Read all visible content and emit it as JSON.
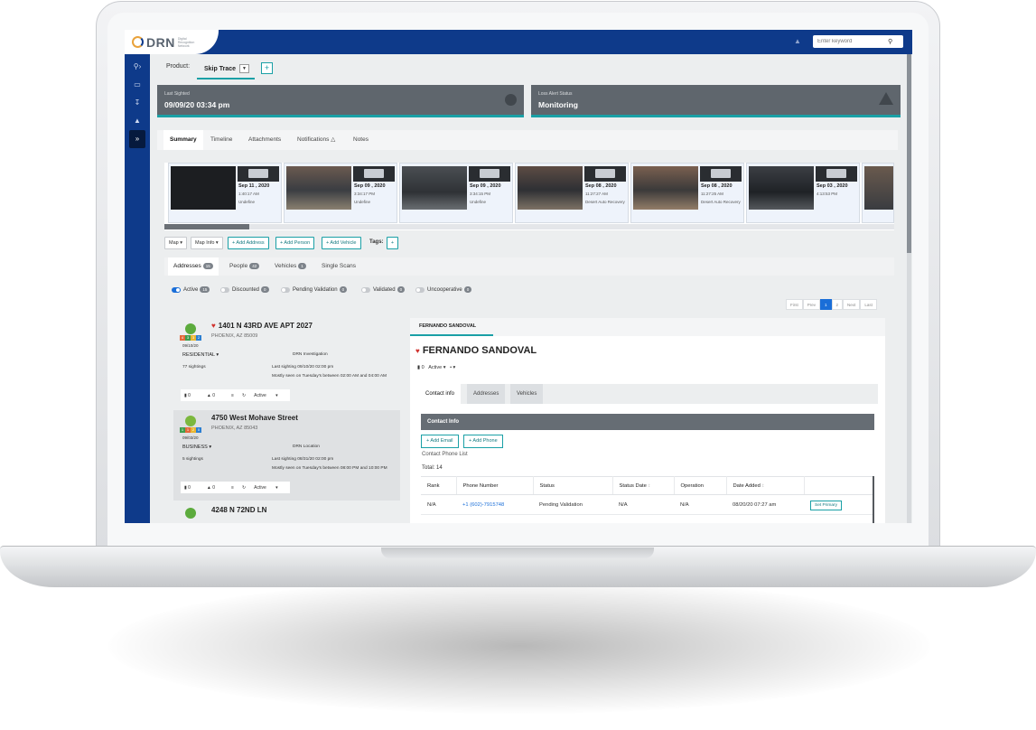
{
  "app": {
    "brand": "DRN",
    "brand_sub": "Digital Recognition Network",
    "search_placeholder": "Enter keyword"
  },
  "icons": {
    "sidebar": [
      "search-arrow-icon",
      "car-icon",
      "download-icon",
      "bell-icon",
      "double-chevron-right-icon"
    ],
    "topbar_bell": "bell-icon",
    "search": "magnifier-icon"
  },
  "colors": {
    "brand_blue": "#0e3a8a",
    "accent_teal": "#1aa0a6",
    "card_gray": "#5f666d",
    "link_blue": "#1a6ed8"
  },
  "product": {
    "label": "Product:",
    "selected": "Skip Trace"
  },
  "cards": {
    "last_sighted_label": "Last Sighted",
    "last_sighted_value": "09/09/20 03:34 pm",
    "loss_alert_label": "Loss Alert Status",
    "loss_alert_value": "Monitoring"
  },
  "tabs": [
    "Summary",
    "Timeline",
    "Attachments",
    "Notifications",
    "Notes"
  ],
  "sightings": [
    {
      "date": "Sep 11 , 2020",
      "time": "1:40:17 AM",
      "source": "Undefine"
    },
    {
      "date": "Sep 09 , 2020",
      "time": "3:34:17 PM",
      "source": "Undefine"
    },
    {
      "date": "Sep 09 , 2020",
      "time": "3:34:15 PM",
      "source": "Undefine"
    },
    {
      "date": "Sep 08 , 2020",
      "time": "11:27:27 AM",
      "source": "Desert Auto Recovery"
    },
    {
      "date": "Sep 08 , 2020",
      "time": "11:27:25 AM",
      "source": "Desert Auto Recovery"
    },
    {
      "date": "Sep 03 , 2020",
      "time": "4:13:53 PM",
      "source": ""
    }
  ],
  "buttons": {
    "map": "Map",
    "map_info": "Map Info",
    "add_address": "+ Add Address",
    "add_person": "+ Add Person",
    "add_vehicle": "+ Add Vehicle",
    "tags": "Tags:"
  },
  "subtabs": [
    {
      "label": "Addresses",
      "count": "15"
    },
    {
      "label": "People",
      "count": "42"
    },
    {
      "label": "Vehicles",
      "count": "1"
    },
    {
      "label": "Single Scans",
      "count": ""
    }
  ],
  "filters": [
    {
      "label": "Active",
      "count": "15",
      "on": true
    },
    {
      "label": "Discounted",
      "count": "0",
      "on": false
    },
    {
      "label": "Pending Validation",
      "count": "0",
      "on": false
    },
    {
      "label": "Validated",
      "count": "0",
      "on": false
    },
    {
      "label": "Uncooperative",
      "count": "0",
      "on": false
    }
  ],
  "pager": [
    "First",
    "Prev",
    "1",
    "2",
    "Next",
    "Last"
  ],
  "addresses": [
    {
      "title": "1401 N 43RD AVE APT 2027",
      "city": "PHOENIX, AZ 85009",
      "date": "09/10/20",
      "type": "RESIDENTIAL",
      "sightings": "77 sightings",
      "source": "DRN Investigation",
      "last": "Last sighting 09/10/20 02:00 pm",
      "most": "Mostly seen on Tuesday's between 02:00 AM and 04:00 AM",
      "n1": "0",
      "n2": "0",
      "status": "Active"
    },
    {
      "title": "4750 West Mohave Street",
      "city": "PHOENIX, AZ 85043",
      "date": "09/03/20",
      "type": "BUSINESS",
      "sightings": "5 sightings",
      "source": "DRN Location",
      "last": "Last sighting 08/31/20 02:00 pm",
      "most": "Mostly seen on Tuesday's between 08:00 PM and 10:00 PM",
      "n1": "0",
      "n2": "0",
      "status": "Active"
    },
    {
      "title": "4248 N 72ND LN",
      "city": "",
      "date": "",
      "type": "",
      "sightings": "",
      "source": "",
      "last": "",
      "most": "",
      "n1": "",
      "n2": "",
      "status": ""
    }
  ],
  "person": {
    "tab": "FERNANDO SANDOVAL",
    "name": "FERNANDO SANDOVAL",
    "count": "0",
    "status": "Active",
    "tabs": [
      "Contact info",
      "Addresses",
      "Vehicles"
    ],
    "contact_header": "Contact Info",
    "add_email": "+ Add Email",
    "add_phone": "+ Add Phone",
    "phone_list_label": "Contact Phone List",
    "total": "Total: 14",
    "columns": [
      "Rank",
      "Phone Number",
      "Status",
      "Status Date",
      "Operation",
      "Date Added",
      ""
    ],
    "rows": [
      {
        "rank": "N/A",
        "phone": "+1 (602)-7915748",
        "status": "Pending Validation",
        "status_date": "N/A",
        "operation": "N/A",
        "date_added": "08/20/20 07:27 am",
        "action": "Set Primary"
      }
    ]
  }
}
